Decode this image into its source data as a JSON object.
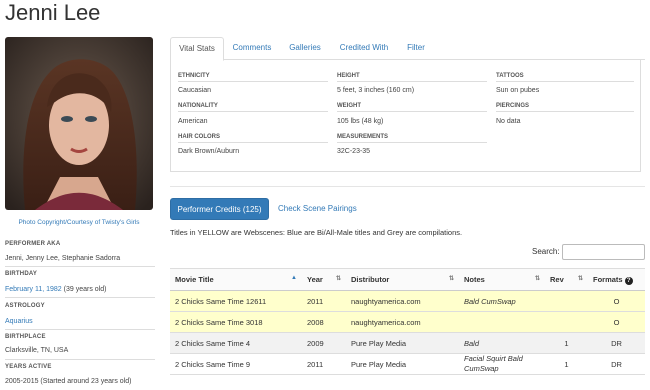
{
  "page": {
    "title": "Jenni Lee"
  },
  "photo": {
    "credit": "Photo Copyright/Courtesy of Twisty's Girls"
  },
  "sidebar": {
    "aka_label": "PERFORMER AKA",
    "aka_value": "Jenni, Jenny Lee, Stephanie Sadorra",
    "birthday_label": "BIRTHDAY",
    "birthday_date": "February 11, 1982",
    "birthday_age": "(39 years old)",
    "astrology_label": "ASTROLOGY",
    "astrology_value": "Aquarius",
    "birthplace_label": "BIRTHPLACE",
    "birthplace_value": "Clarksville, TN, USA",
    "years_label": "YEARS ACTIVE",
    "years_value": "2005-2015 (Started around 23 years old)"
  },
  "tabs": [
    "Vital Stats",
    "Comments",
    "Galleries",
    "Credited With",
    "Filter"
  ],
  "stats": {
    "ethnicity_label": "ETHNICITY",
    "ethnicity": "Caucasian",
    "nationality_label": "NATIONALITY",
    "nationality": "American",
    "hair_label": "HAIR COLORS",
    "hair": "Dark Brown/Auburn",
    "height_label": "HEIGHT",
    "height": "5 feet, 3 inches (160 cm)",
    "weight_label": "WEIGHT",
    "weight": "105 lbs (48 kg)",
    "measurements_label": "MEASUREMENTS",
    "measurements": "32C-23-35",
    "tattoos_label": "TATTOOS",
    "tattoos": "Sun on pubes",
    "piercings_label": "PIERCINGS",
    "piercings": "No data"
  },
  "credits_button": "Performer Credits (125)",
  "pairings_link": "Check Scene Pairings",
  "legend_text": "Titles in YELLOW are Webscenes: Blue are Bi/All-Male titles and Grey are compilations.",
  "search": {
    "label": "Search:",
    "value": ""
  },
  "table": {
    "headers": [
      "Movie Title",
      "Year",
      "Distributor",
      "Notes",
      "Rev",
      "Formats"
    ],
    "rows": [
      {
        "title": "2 Chicks Same Time 12611",
        "year": "2011",
        "distributor": "naughtyamerica.com",
        "notes": "Bald CumSwap",
        "rev": "",
        "formats": "O"
      },
      {
        "title": "2 Chicks Same Time 3018",
        "year": "2008",
        "distributor": "naughtyamerica.com",
        "notes": "",
        "rev": "",
        "formats": "O"
      },
      {
        "title": "2 Chicks Same Time 4",
        "year": "2009",
        "distributor": "Pure Play Media",
        "notes": "Bald",
        "rev": "1",
        "formats": "DR"
      },
      {
        "title": "2 Chicks Same Time 9",
        "year": "2011",
        "distributor": "Pure Play Media",
        "notes": "Facial Squirt Bald CumSwap",
        "rev": "1",
        "formats": "DR"
      }
    ]
  }
}
